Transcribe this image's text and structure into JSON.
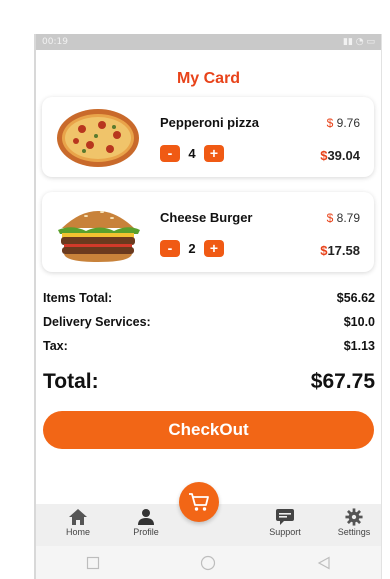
{
  "status_bar": {
    "time": "00:19",
    "left_icons": "signal wifi",
    "right_icons": "alarm battery"
  },
  "page": {
    "title": "My Card"
  },
  "cart": {
    "items": [
      {
        "name": "Pepperoni pizza",
        "currency": "$",
        "unit_price": "9.76",
        "quantity": "4",
        "line_total": "39.04",
        "image": "pizza-image"
      },
      {
        "name": "Cheese Burger",
        "currency": "$",
        "unit_price": "8.79",
        "quantity": "2",
        "line_total": "17.58",
        "image": "burger-image"
      }
    ],
    "minus_label": "-",
    "plus_label": "+"
  },
  "summary": {
    "items_total_label": "Items Total:",
    "items_total_value": "$56.62",
    "delivery_label": "Delivery Services:",
    "delivery_value": "$10.0",
    "tax_label": "Tax:",
    "tax_value": "$1.13",
    "total_label": "Total:",
    "total_value": "$67.75"
  },
  "checkout_label": "CheckOut",
  "tabs": [
    {
      "label": "Home",
      "icon": "home-icon"
    },
    {
      "label": "Profile",
      "icon": "person-icon"
    },
    {
      "label": "Support",
      "icon": "chat-icon"
    },
    {
      "label": "Settings",
      "icon": "gear-icon"
    }
  ],
  "fab": {
    "icon": "cart-icon"
  },
  "colors": {
    "accent": "#f26616",
    "title": "#e8431a"
  }
}
